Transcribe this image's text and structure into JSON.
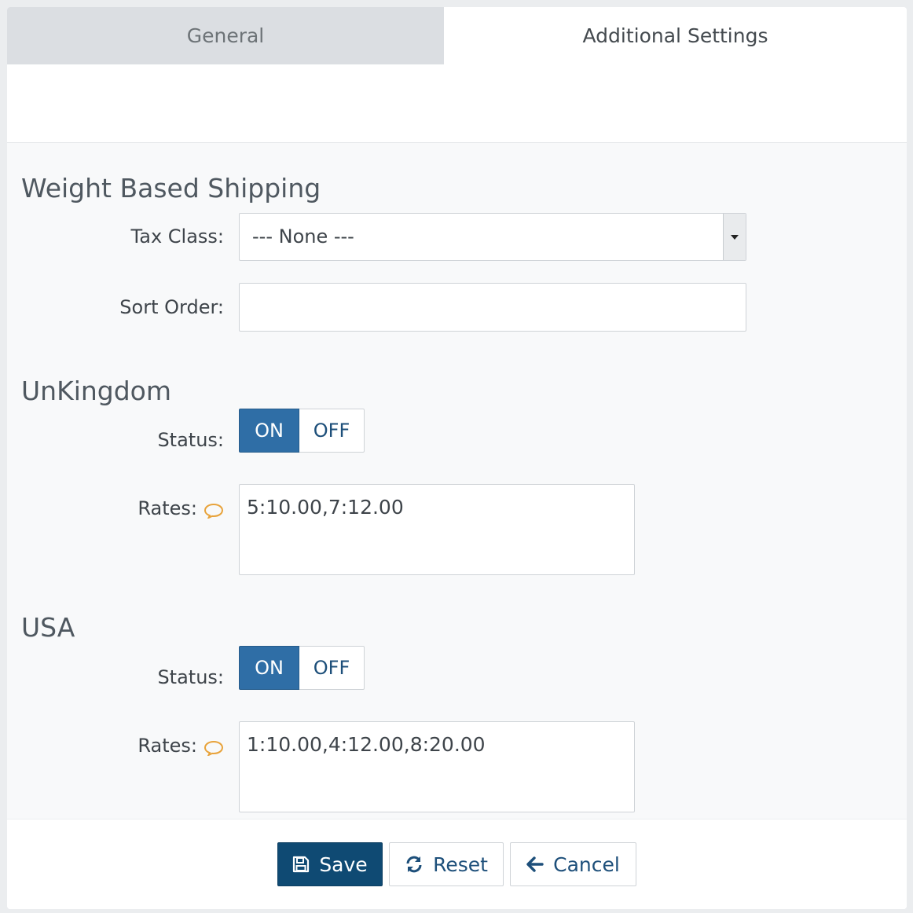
{
  "tabs": [
    {
      "label": "General",
      "active": false
    },
    {
      "label": "Additional Settings",
      "active": true
    }
  ],
  "settings": {
    "title": "Weight Based Shipping",
    "tax_class": {
      "label": "Tax Class:",
      "value": "--- None ---"
    },
    "sort_order": {
      "label": "Sort Order:",
      "value": ""
    }
  },
  "zones": [
    {
      "title": "UnKingdom",
      "status": {
        "label": "Status:",
        "on_label": "ON",
        "off_label": "OFF",
        "value": "ON"
      },
      "rates": {
        "label": "Rates:",
        "value": "5:10.00,7:12.00",
        "hint_icon": "comment-icon"
      }
    },
    {
      "title": "USA",
      "status": {
        "label": "Status:",
        "on_label": "ON",
        "off_label": "OFF",
        "value": "ON"
      },
      "rates": {
        "label": "Rates:",
        "value": "1:10.00,4:12.00,8:20.00",
        "hint_icon": "comment-icon"
      }
    }
  ],
  "actions": {
    "save_label": "Save",
    "reset_label": "Reset",
    "cancel_label": "Cancel"
  },
  "colors": {
    "primary": "#0f4a73",
    "toggle_on": "#2f6ea6",
    "hint_icon": "#e8a33b"
  }
}
